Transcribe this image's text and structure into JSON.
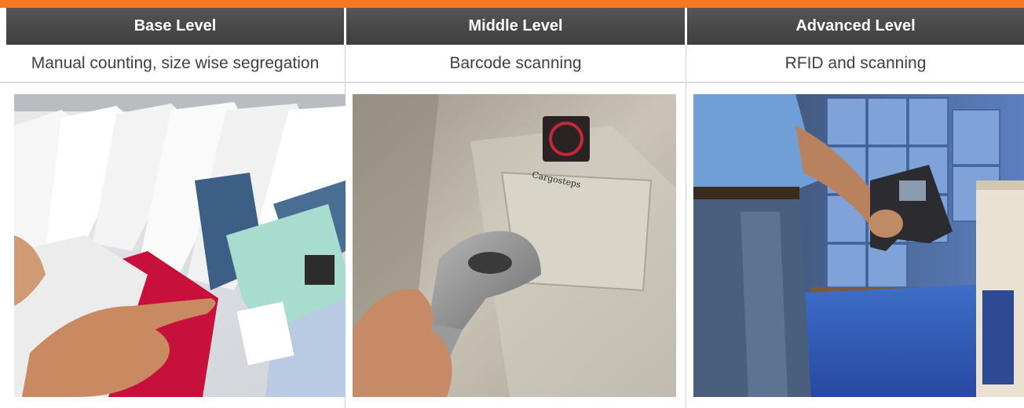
{
  "levels": [
    {
      "title": "Base Level",
      "description": "Manual counting, size wise segregation",
      "image_subject": "hands-sorting-shirts-on-hangers"
    },
    {
      "title": "Middle Level",
      "description": "Barcode scanning",
      "image_subject": "handheld-barcode-scanner-on-shirt"
    },
    {
      "title": "Advanced Level",
      "description": "RFID and scanning",
      "image_subject": "worker-with-rfid-scanner-in-warehouse"
    }
  ],
  "colors": {
    "accent": "#f47920",
    "header_bg": "#464646",
    "header_text": "#ffffff",
    "desc_text": "#404040"
  }
}
